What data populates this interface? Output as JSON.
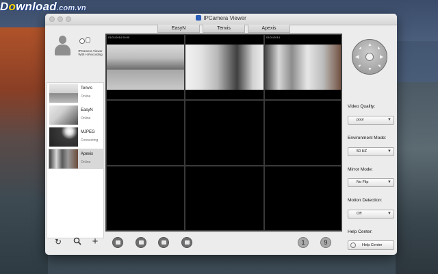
{
  "watermark": {
    "brand_main": "D",
    "brand_o": "o",
    "brand_rest": "wnload",
    "domain": ".com.vn"
  },
  "window": {
    "title": "IPCamera Viewer"
  },
  "tabs": [
    {
      "label": "EasyN"
    },
    {
      "label": "Tenvis"
    },
    {
      "label": "Apexis"
    }
  ],
  "profile": {
    "caption_line1": "IPCamera Viewer",
    "caption_line2": "With H.Recording"
  },
  "cameras": [
    {
      "name": "Tenvis",
      "status": "Online"
    },
    {
      "name": "EasyN",
      "status": "Online"
    },
    {
      "name": "MJPEG",
      "status": "Connecting"
    },
    {
      "name": "Apexis",
      "status": "Online",
      "selected": true
    }
  ],
  "sidebar_bottom": {
    "refresh_icon": "refresh-icon",
    "search_icon": "search-icon",
    "add_icon": "plus-icon"
  },
  "bottom_bar": {
    "snapshot_icon": "camera-icon",
    "record_icon": "video-camera-icon",
    "photos_icon": "photo-icon",
    "film_icon": "film-icon",
    "layout_one_label": "1",
    "layout_nine_label": "9"
  },
  "controls": {
    "video_quality": {
      "label": "Video Quality:",
      "value": "poor"
    },
    "environment_mode": {
      "label": "Environment Mode:",
      "value": "50 HZ"
    },
    "mirror_mode": {
      "label": "Mirror Mode:",
      "value": "No Flip"
    },
    "motion_detection": {
      "label": "Motion Detection:",
      "value": "Off"
    },
    "help_center": {
      "label": "Help Center:",
      "button": "Help Center"
    }
  },
  "feeds": [
    {
      "hud": "01/01/2014 00:00"
    },
    {
      "hud": ""
    },
    {
      "hud": "01/01/2014"
    }
  ]
}
